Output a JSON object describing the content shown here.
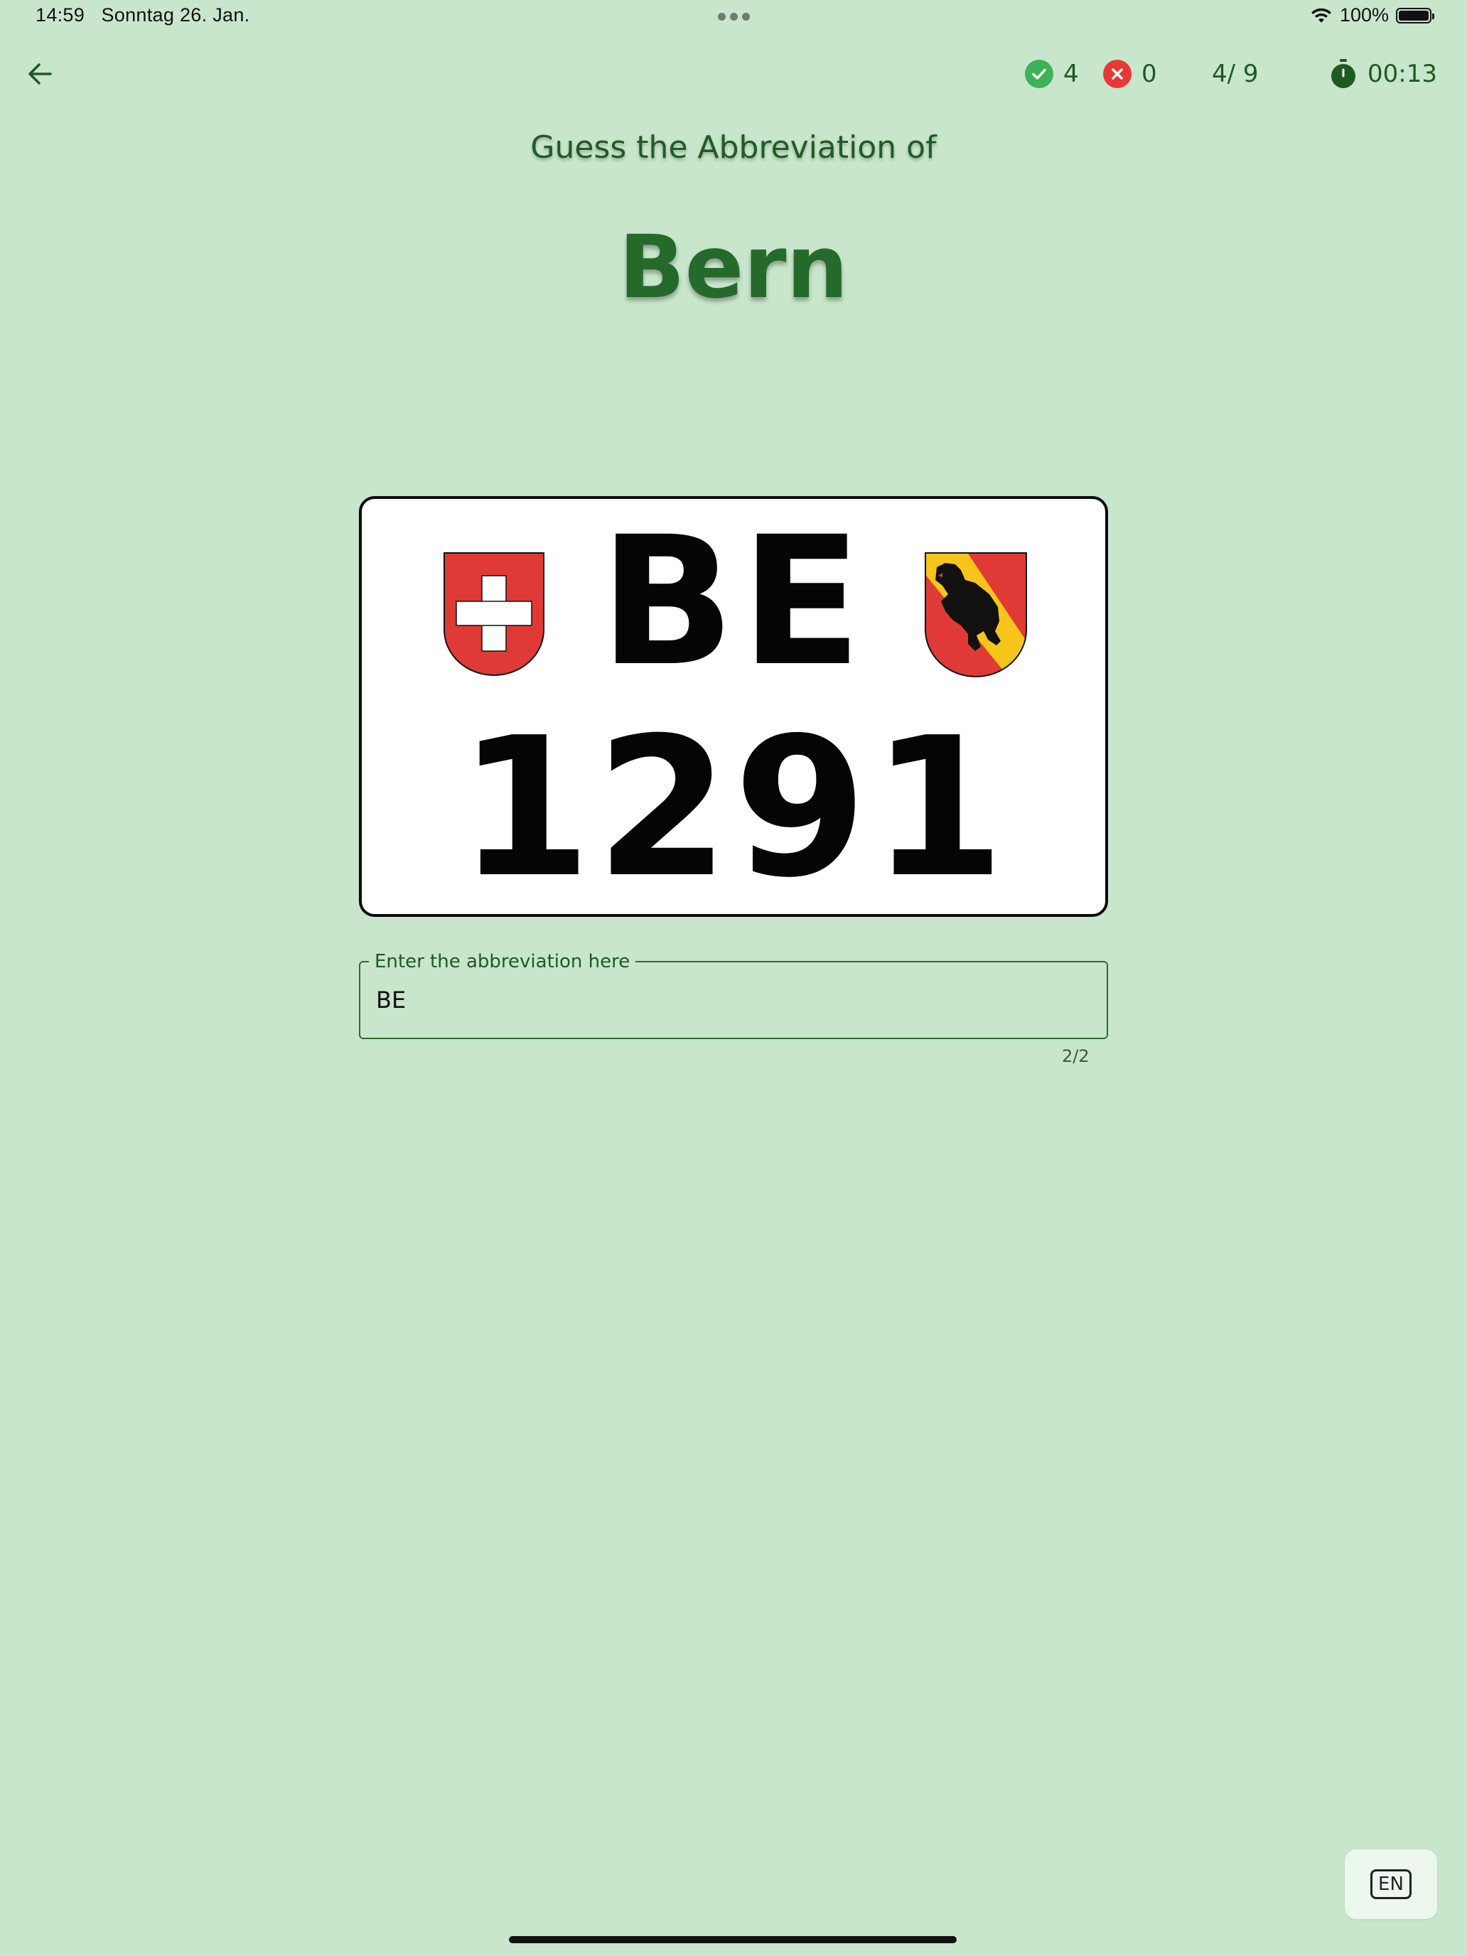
{
  "status_bar": {
    "time": "14:59",
    "date": "Sonntag 26. Jan.",
    "battery": "100%",
    "battery_level": 1.0,
    "icons": [
      "wifi-icon",
      "battery-icon"
    ]
  },
  "app_bar": {
    "back_icon": "arrow-left-icon",
    "correct_count": "4",
    "wrong_count": "0",
    "progress": "4/ 9",
    "timer": "00:13",
    "icons": [
      "check-circle-icon",
      "x-circle-icon",
      "stopwatch-icon"
    ],
    "colors": {
      "correct": "#3fb157",
      "wrong": "#e53935",
      "primary": "#1e5a23"
    }
  },
  "question": {
    "prompt": "Guess the Abbreviation of",
    "city": "Bern"
  },
  "plate": {
    "code": "BE",
    "number": "1291",
    "left_emblem": "swiss-coat-of-arms",
    "right_emblem": "bern-coat-of-arms"
  },
  "answer_field": {
    "label": "Enter the abbreviation here",
    "value": "BE",
    "counter": "2/2"
  },
  "language_button": {
    "label": "EN"
  }
}
